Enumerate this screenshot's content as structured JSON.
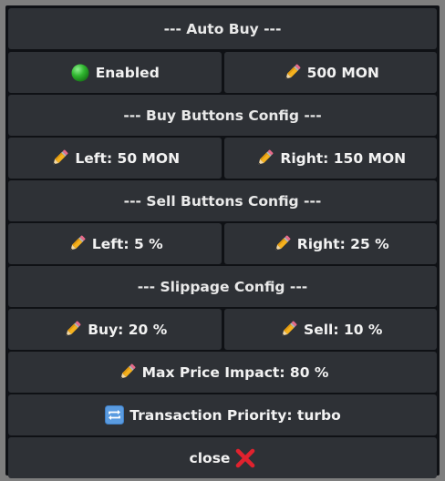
{
  "auto_buy": {
    "header": "--- Auto Buy ---",
    "status_label": "Enabled",
    "amount_label": "500 MON"
  },
  "buy_buttons": {
    "header": "--- Buy Buttons Config ---",
    "left_label": "Left: 50 MON",
    "right_label": "Right: 150 MON"
  },
  "sell_buttons": {
    "header": "--- Sell Buttons Config ---",
    "left_label": "Left: 5 %",
    "right_label": "Right: 25 %"
  },
  "slippage": {
    "header": "--- Slippage Config ---",
    "buy_label": "Buy: 20 %",
    "sell_label": "Sell: 10 %"
  },
  "max_price_impact_label": "Max Price Impact: 80 %",
  "transaction_priority_label": "Transaction Priority: turbo",
  "close_label": "close",
  "icons": {
    "status": "green-circle-icon",
    "edit": "pencil-icon",
    "priority": "repeat-arrows-icon",
    "close": "red-x-icon"
  },
  "colors": {
    "status_green": "#2fb52f",
    "close_red": "#e0222e",
    "button_bg": "#2e3136"
  }
}
